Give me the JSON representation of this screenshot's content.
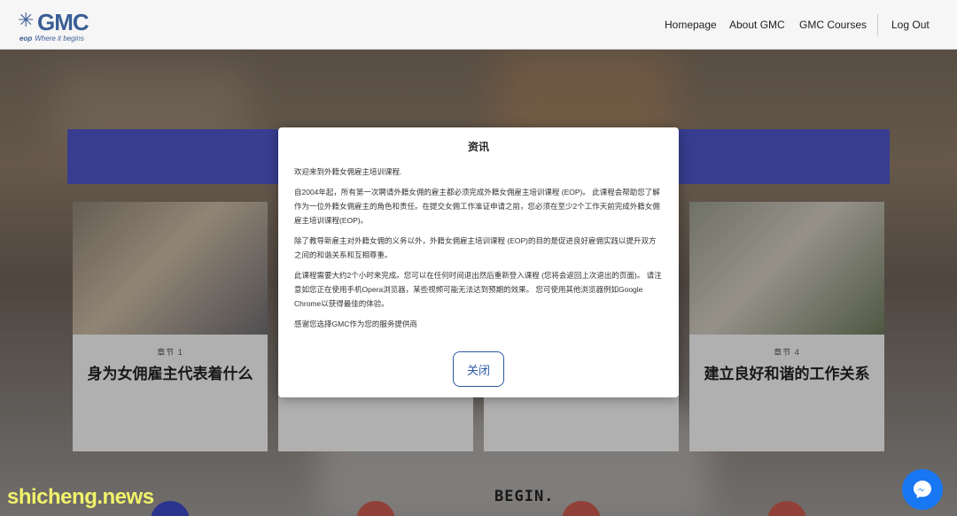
{
  "header": {
    "logo": {
      "text": "GMC",
      "tagline_bold": "eop",
      "tagline": "Where it begins"
    },
    "nav": {
      "home": "Homepage",
      "about": "About GMC",
      "courses": "GMC Courses",
      "logout": "Log Out"
    }
  },
  "chapters": [
    {
      "label": "章节 1",
      "title": "身为女佣雇主代表着什么"
    },
    {
      "label": "章节 4",
      "title": "建立良好和谐的工作关系"
    }
  ],
  "background": {
    "begin_text": "BEGIN."
  },
  "modal": {
    "title": "资讯",
    "paragraphs": [
      "欢迎来到外籍女佣雇主培训课程.",
      "自2004年起，所有第一次聘请外籍女佣的雇主都必须完成外籍女佣雇主培训课程 (EOP)。 此课程会帮助您了解作为一位外籍女佣雇主的角色和责任。在提交女佣工作准证申请之前，您必须在至少2个工作天前完成外籍女佣雇主培训课程(EOP)。",
      "除了教导新雇主对外籍女佣的义务以外，外籍女佣雇主培训课程 (EOP)的目的是促进良好雇佣实践以提升双方之间的和谐关系和互相尊重。",
      "此课程需要大约2个小时来完成。您可以在任何时间退出然后重新登入课程 (您将会返回上次退出的页面)。 请注意如您正在使用手机Opera浏览器，某些视频可能无法达到预期的效果。 您可使用其他浏览器例如Google Chrome以获得最佳的体验。",
      "感谢您选择GMC作为您的服务提供商"
    ],
    "close_label": "关闭"
  },
  "watermark": "shicheng.news",
  "colors": {
    "brand": "#3a5e96",
    "banner": "#4e55c8",
    "close_border": "#2b59a3",
    "messenger": "#1877f2",
    "watermark": "#f2f26a"
  },
  "icons": {
    "messenger": "messenger-icon",
    "logo": "gmc-logo-icon"
  }
}
